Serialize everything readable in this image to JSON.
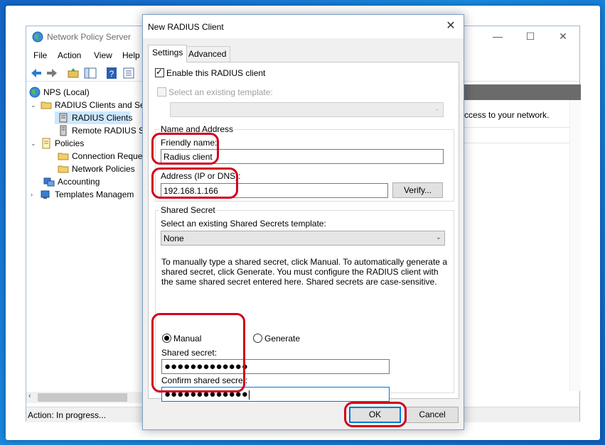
{
  "nps": {
    "title": "Network Policy Server",
    "menu": [
      "File",
      "Action",
      "View",
      "Help"
    ],
    "tree": {
      "root": "NPS (Local)",
      "radius_clients_and_servers": "RADIUS Clients and Se",
      "radius_clients": "RADIUS Clients",
      "remote_radius": "Remote RADIUS Se",
      "policies": "Policies",
      "connection_request": "Connection Reque",
      "network_policies": "Network Policies",
      "accounting": "Accounting",
      "templates": "Templates Managem"
    },
    "right_text": "ccess to your network.",
    "status": "Action:  In progress..."
  },
  "dialog": {
    "title": "New RADIUS Client",
    "close_symbol": "✕",
    "tabs": [
      "Settings",
      "Advanced"
    ],
    "enable_label": "Enable this RADIUS client",
    "enable_checked": true,
    "select_template_label": "Select an existing template:",
    "select_template_checked": false,
    "template_value": "",
    "name_address": {
      "title": "Name and Address",
      "friendly_label": "Friendly name:",
      "friendly_value": "Radius client",
      "address_label": "Address (IP or DNS):",
      "address_value": "192.168.1.166",
      "verify_label": "Verify..."
    },
    "shared_secret": {
      "title": "Shared Secret",
      "template_label": "Select an existing Shared Secrets template:",
      "template_value": "None",
      "instructions": "To manually type a shared secret, click Manual. To automatically generate a shared secret, click Generate. You must configure the RADIUS client with the same shared secret entered here. Shared secrets are case-sensitive.",
      "manual_label": "Manual",
      "generate_label": "Generate",
      "selected_mode": "Manual",
      "secret_label": "Shared secret:",
      "secret_value": "●●●●●●●●●●●●●",
      "confirm_label": "Confirm shared secret:",
      "confirm_value": "●●●●●●●●●●●●●"
    },
    "ok_label": "OK",
    "cancel_label": "Cancel"
  },
  "colors": {
    "highlight": "#d0021b",
    "focus_border": "#0078d7",
    "desktop": "#1a7fd8"
  },
  "icons": {
    "nps": "network-globe-icon",
    "back": "arrow-left-icon",
    "forward": "arrow-right-icon",
    "help": "help-icon",
    "close": "close-icon"
  }
}
